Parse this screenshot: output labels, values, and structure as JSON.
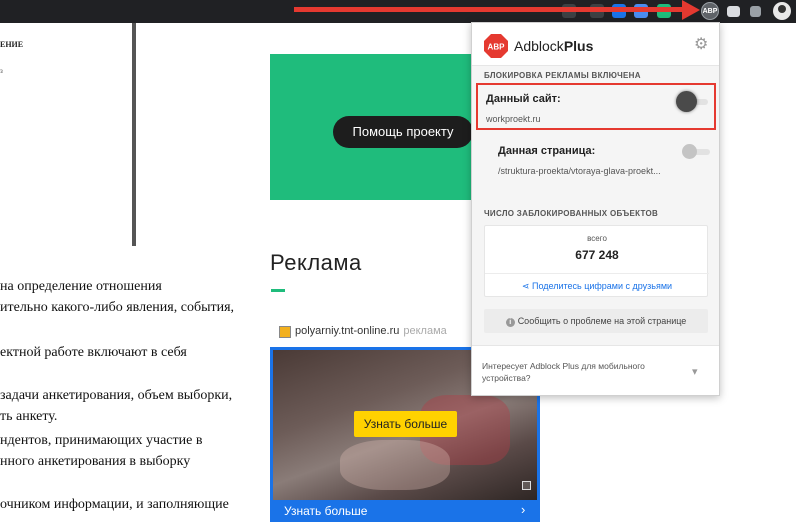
{
  "browser": {
    "abp_badge": "ABP"
  },
  "article": {
    "toc_title": "ЕНИЕ",
    "toc_sub": "з",
    "lines": [
      "на определение отношения",
      "ительно какого-либо явления, события,",
      "ектной работе включают в себя",
      "задачи анкетирования, объем выборки,",
      "ть анкету.",
      "ндентов, принимающих участие в",
      "нного анкетирования в выборку",
      "очником информации, и заполняющие"
    ]
  },
  "sidebar": {
    "help_button": "Помощь проекту",
    "ad_heading": "Реклама"
  },
  "ad": {
    "source": "polyarniy.tnt-online.ru",
    "source_tag": "реклама",
    "cta": "Узнать больше",
    "footer": "Узнать больше",
    "footer_chevron": "›"
  },
  "popup": {
    "brand_regular": "Adblock",
    "brand_bold": "Plus",
    "logo_text": "ABP",
    "gear_icon": "⚙",
    "blocking_caption": "БЛОКИРОВКА РЕКЛАМЫ ВКЛЮЧЕНА",
    "site_label": "Данный сайт:",
    "site_url": "workproekt.ru",
    "page_label": "Данная страница:",
    "page_url": "/struktura-proekta/vtoraya-glava-proekt...",
    "blocked_caption": "ЧИСЛО ЗАБЛОКИРОВАННЫХ ОБЪЕКТОВ",
    "total_label": "всего",
    "total_value": "677 248",
    "share_text": "Поделитесь цифрами с друзьями",
    "report_text": "Сообщить о проблеме на этой странице",
    "report_icon": "i",
    "mobile_text": "Интересует Adblock Plus для мобильного устройства?",
    "apple_icon": "",
    "android_icon": "▾"
  },
  "colors": {
    "accent_green": "#1fbc7c",
    "abp_red": "#e53930",
    "link_blue": "#1a73e8",
    "cta_yellow": "#ffd200"
  }
}
